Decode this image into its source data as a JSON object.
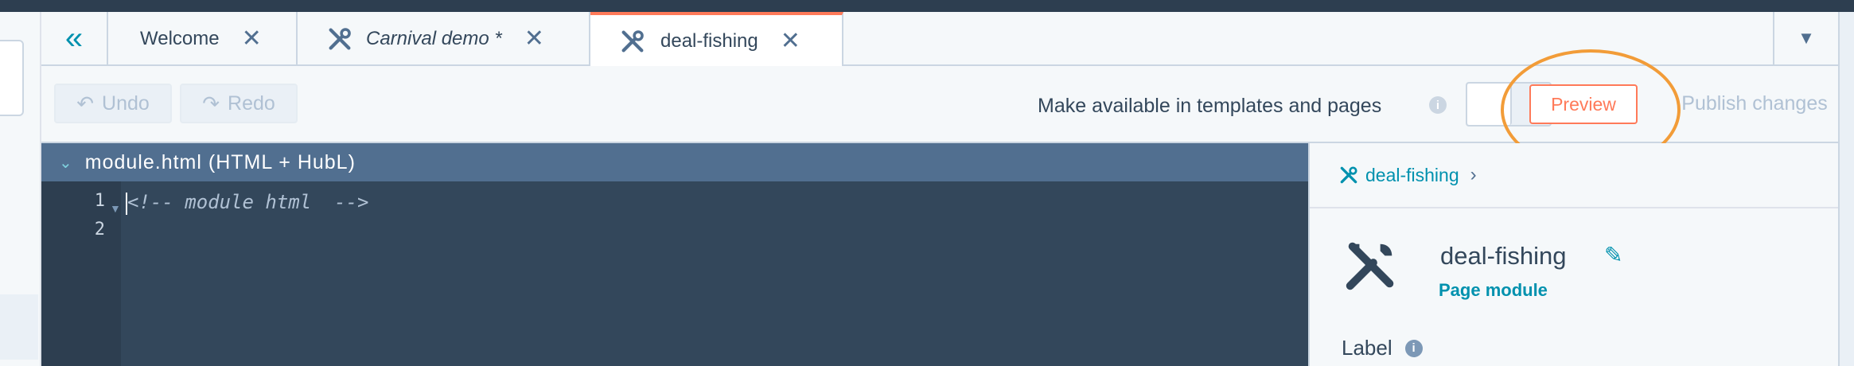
{
  "tabs": [
    {
      "label": "Welcome"
    },
    {
      "label": "Carnival demo *"
    },
    {
      "label": "deal-fishing"
    }
  ],
  "toolbar": {
    "undo_label": "Undo",
    "redo_label": "Redo",
    "availability_label": "Make available in templates and pages",
    "preview_label": "Preview",
    "publish_label": "Publish changes"
  },
  "editor": {
    "file_label": "module.html (HTML + HubL)",
    "line_numbers": [
      "1",
      "2"
    ],
    "code_line_1": "<!-- module html  -->"
  },
  "sidebar": {
    "breadcrumb": "deal-fishing",
    "module_name": "deal-fishing",
    "module_type": "Page module",
    "label_heading": "Label"
  },
  "colors": {
    "accent_orange": "#ff7a59",
    "link_teal": "#0091ae",
    "editor_bg": "#33475b",
    "annotation_circle": "#f29c38"
  }
}
